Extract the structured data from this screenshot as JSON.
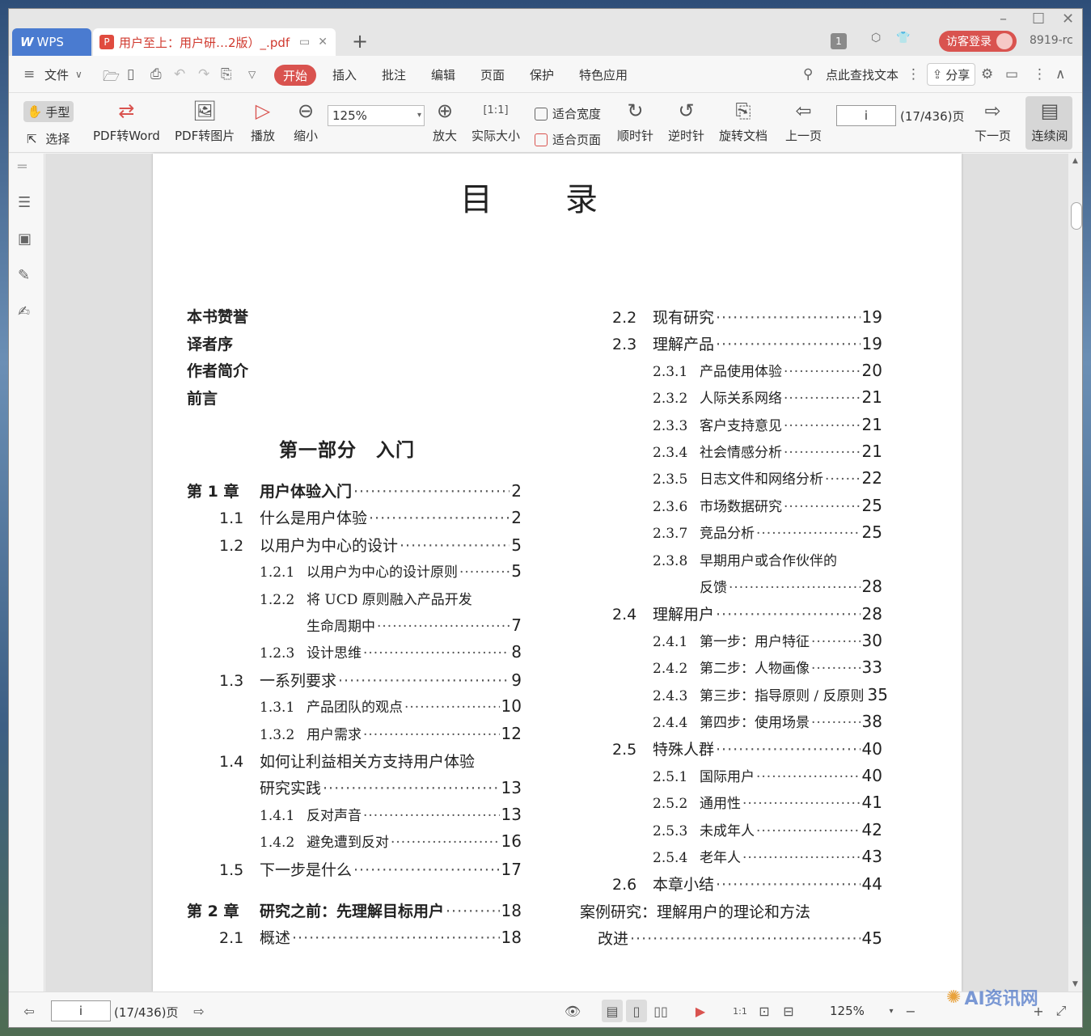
{
  "tabbar": {
    "app_tab": "WPS",
    "doc_tab": "用户至上：用户研…2版）_.pdf",
    "login": "访客登录",
    "badge": "1",
    "user_id": "8919-rc"
  },
  "menubar": {
    "file": "文件",
    "start": "开始",
    "items": [
      "插入",
      "批注",
      "编辑",
      "页面",
      "保护",
      "特色应用"
    ],
    "search": "点此查找文本",
    "share": "分享"
  },
  "ribbon": {
    "hand": "手型",
    "select": "选择",
    "pdf_word": "PDF转Word",
    "pdf_img": "PDF转图片",
    "play": "播放",
    "zoom_out": "缩小",
    "zoom_value": "125%",
    "zoom_in": "放大",
    "actual": "实际大小",
    "fit_width": "适合宽度",
    "fit_page": "适合页面",
    "cw": "顺时针",
    "ccw": "逆时针",
    "rotate": "旋转文档",
    "prev": "上一页",
    "page_value": "i",
    "page_count": "(17/436)页",
    "next": "下一页",
    "continuous": "连续阅"
  },
  "page": {
    "title": "目录",
    "front": [
      "本书赞誉",
      "译者序",
      "作者简介",
      "前言"
    ],
    "part_title": "第一部分　入门",
    "left": [
      {
        "num": "第 1 章",
        "text": "用户体验入门",
        "page": "2",
        "lvl": 0
      },
      {
        "num": "1.1",
        "text": "什么是用户体验",
        "page": "2",
        "lvl": 1
      },
      {
        "num": "1.2",
        "text": "以用户为中心的设计",
        "page": "5",
        "lvl": 1
      },
      {
        "num": "1.2.1",
        "text": "以用户为中心的设计原则",
        "page": "5",
        "lvl": 2
      },
      {
        "num": "1.2.2",
        "text": "将 UCD 原则融入产品开发",
        "page": "",
        "lvl": 2
      },
      {
        "num": "",
        "text": "生命周期中",
        "page": "7",
        "lvl": 3
      },
      {
        "num": "1.2.3",
        "text": "设计思维",
        "page": "8",
        "lvl": 2
      },
      {
        "num": "1.3",
        "text": "一系列要求",
        "page": "9",
        "lvl": 1
      },
      {
        "num": "1.3.1",
        "text": "产品团队的观点",
        "page": "10",
        "lvl": 2
      },
      {
        "num": "1.3.2",
        "text": "用户需求",
        "page": "12",
        "lvl": 2
      },
      {
        "num": "1.4",
        "text": "如何让利益相关方支持用户体验",
        "page": "",
        "lvl": 1
      },
      {
        "num": "",
        "text": "研究实践",
        "page": "13",
        "lvl": 4
      },
      {
        "num": "1.4.1",
        "text": "反对声音",
        "page": "13",
        "lvl": 2
      },
      {
        "num": "1.4.2",
        "text": "避免遭到反对",
        "page": "16",
        "lvl": 2
      },
      {
        "num": "1.5",
        "text": "下一步是什么",
        "page": "17",
        "lvl": 1
      },
      {
        "num": "第 2 章",
        "text": "研究之前：先理解目标用户",
        "page": "18",
        "lvl": 0
      },
      {
        "num": "2.1",
        "text": "概述",
        "page": "18",
        "lvl": 1
      }
    ],
    "right": [
      {
        "num": "2.2",
        "text": "现有研究",
        "page": "19",
        "lvl": 1
      },
      {
        "num": "2.3",
        "text": "理解产品",
        "page": "19",
        "lvl": 1
      },
      {
        "num": "2.3.1",
        "text": "产品使用体验",
        "page": "20",
        "lvl": 2
      },
      {
        "num": "2.3.2",
        "text": "人际关系网络",
        "page": "21",
        "lvl": 2
      },
      {
        "num": "2.3.3",
        "text": "客户支持意见",
        "page": "21",
        "lvl": 2
      },
      {
        "num": "2.3.4",
        "text": "社会情感分析",
        "page": "21",
        "lvl": 2
      },
      {
        "num": "2.3.5",
        "text": "日志文件和网络分析",
        "page": "22",
        "lvl": 2
      },
      {
        "num": "2.3.6",
        "text": "市场数据研究",
        "page": "25",
        "lvl": 2
      },
      {
        "num": "2.3.7",
        "text": "竞品分析",
        "page": "25",
        "lvl": 2
      },
      {
        "num": "2.3.8",
        "text": "早期用户或合作伙伴的",
        "page": "",
        "lvl": 2
      },
      {
        "num": "",
        "text": "反馈",
        "page": "28",
        "lvl": 3
      },
      {
        "num": "2.4",
        "text": "理解用户",
        "page": "28",
        "lvl": 1
      },
      {
        "num": "2.4.1",
        "text": "第一步：用户特征",
        "page": "30",
        "lvl": 2
      },
      {
        "num": "2.4.2",
        "text": "第二步：人物画像",
        "page": "33",
        "lvl": 2
      },
      {
        "num": "2.4.3",
        "text": "第三步：指导原则 / 反原则",
        "page": "35",
        "lvl": 2
      },
      {
        "num": "2.4.4",
        "text": "第四步：使用场景",
        "page": "38",
        "lvl": 2
      },
      {
        "num": "2.5",
        "text": "特殊人群",
        "page": "40",
        "lvl": 1
      },
      {
        "num": "2.5.1",
        "text": "国际用户",
        "page": "40",
        "lvl": 2
      },
      {
        "num": "2.5.2",
        "text": "通用性",
        "page": "41",
        "lvl": 2
      },
      {
        "num": "2.5.3",
        "text": "未成年人",
        "page": "42",
        "lvl": 2
      },
      {
        "num": "2.5.4",
        "text": "老年人",
        "page": "43",
        "lvl": 2
      },
      {
        "num": "2.6",
        "text": "本章小结",
        "page": "44",
        "lvl": 1
      },
      {
        "num": "",
        "text": "案例研究：理解用户的理论和方法",
        "page": "",
        "lvl": 5
      },
      {
        "num": "",
        "text": "改进",
        "page": "45",
        "lvl": 6
      }
    ]
  },
  "statusbar": {
    "page_value": "i",
    "page_count": "(17/436)页",
    "zoom": "125%"
  },
  "watermark": "AI资讯网"
}
